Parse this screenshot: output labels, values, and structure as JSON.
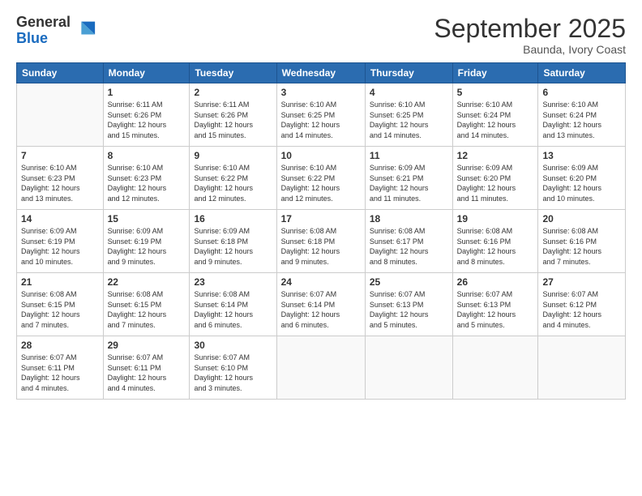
{
  "logo": {
    "general": "General",
    "blue": "Blue"
  },
  "title": "September 2025",
  "location": "Baunda, Ivory Coast",
  "days_of_week": [
    "Sunday",
    "Monday",
    "Tuesday",
    "Wednesday",
    "Thursday",
    "Friday",
    "Saturday"
  ],
  "weeks": [
    [
      {
        "day": "",
        "info": ""
      },
      {
        "day": "1",
        "info": "Sunrise: 6:11 AM\nSunset: 6:26 PM\nDaylight: 12 hours\nand 15 minutes."
      },
      {
        "day": "2",
        "info": "Sunrise: 6:11 AM\nSunset: 6:26 PM\nDaylight: 12 hours\nand 15 minutes."
      },
      {
        "day": "3",
        "info": "Sunrise: 6:10 AM\nSunset: 6:25 PM\nDaylight: 12 hours\nand 14 minutes."
      },
      {
        "day": "4",
        "info": "Sunrise: 6:10 AM\nSunset: 6:25 PM\nDaylight: 12 hours\nand 14 minutes."
      },
      {
        "day": "5",
        "info": "Sunrise: 6:10 AM\nSunset: 6:24 PM\nDaylight: 12 hours\nand 14 minutes."
      },
      {
        "day": "6",
        "info": "Sunrise: 6:10 AM\nSunset: 6:24 PM\nDaylight: 12 hours\nand 13 minutes."
      }
    ],
    [
      {
        "day": "7",
        "info": "Sunrise: 6:10 AM\nSunset: 6:23 PM\nDaylight: 12 hours\nand 13 minutes."
      },
      {
        "day": "8",
        "info": "Sunrise: 6:10 AM\nSunset: 6:23 PM\nDaylight: 12 hours\nand 12 minutes."
      },
      {
        "day": "9",
        "info": "Sunrise: 6:10 AM\nSunset: 6:22 PM\nDaylight: 12 hours\nand 12 minutes."
      },
      {
        "day": "10",
        "info": "Sunrise: 6:10 AM\nSunset: 6:22 PM\nDaylight: 12 hours\nand 12 minutes."
      },
      {
        "day": "11",
        "info": "Sunrise: 6:09 AM\nSunset: 6:21 PM\nDaylight: 12 hours\nand 11 minutes."
      },
      {
        "day": "12",
        "info": "Sunrise: 6:09 AM\nSunset: 6:20 PM\nDaylight: 12 hours\nand 11 minutes."
      },
      {
        "day": "13",
        "info": "Sunrise: 6:09 AM\nSunset: 6:20 PM\nDaylight: 12 hours\nand 10 minutes."
      }
    ],
    [
      {
        "day": "14",
        "info": "Sunrise: 6:09 AM\nSunset: 6:19 PM\nDaylight: 12 hours\nand 10 minutes."
      },
      {
        "day": "15",
        "info": "Sunrise: 6:09 AM\nSunset: 6:19 PM\nDaylight: 12 hours\nand 9 minutes."
      },
      {
        "day": "16",
        "info": "Sunrise: 6:09 AM\nSunset: 6:18 PM\nDaylight: 12 hours\nand 9 minutes."
      },
      {
        "day": "17",
        "info": "Sunrise: 6:08 AM\nSunset: 6:18 PM\nDaylight: 12 hours\nand 9 minutes."
      },
      {
        "day": "18",
        "info": "Sunrise: 6:08 AM\nSunset: 6:17 PM\nDaylight: 12 hours\nand 8 minutes."
      },
      {
        "day": "19",
        "info": "Sunrise: 6:08 AM\nSunset: 6:16 PM\nDaylight: 12 hours\nand 8 minutes."
      },
      {
        "day": "20",
        "info": "Sunrise: 6:08 AM\nSunset: 6:16 PM\nDaylight: 12 hours\nand 7 minutes."
      }
    ],
    [
      {
        "day": "21",
        "info": "Sunrise: 6:08 AM\nSunset: 6:15 PM\nDaylight: 12 hours\nand 7 minutes."
      },
      {
        "day": "22",
        "info": "Sunrise: 6:08 AM\nSunset: 6:15 PM\nDaylight: 12 hours\nand 7 minutes."
      },
      {
        "day": "23",
        "info": "Sunrise: 6:08 AM\nSunset: 6:14 PM\nDaylight: 12 hours\nand 6 minutes."
      },
      {
        "day": "24",
        "info": "Sunrise: 6:07 AM\nSunset: 6:14 PM\nDaylight: 12 hours\nand 6 minutes."
      },
      {
        "day": "25",
        "info": "Sunrise: 6:07 AM\nSunset: 6:13 PM\nDaylight: 12 hours\nand 5 minutes."
      },
      {
        "day": "26",
        "info": "Sunrise: 6:07 AM\nSunset: 6:13 PM\nDaylight: 12 hours\nand 5 minutes."
      },
      {
        "day": "27",
        "info": "Sunrise: 6:07 AM\nSunset: 6:12 PM\nDaylight: 12 hours\nand 4 minutes."
      }
    ],
    [
      {
        "day": "28",
        "info": "Sunrise: 6:07 AM\nSunset: 6:11 PM\nDaylight: 12 hours\nand 4 minutes."
      },
      {
        "day": "29",
        "info": "Sunrise: 6:07 AM\nSunset: 6:11 PM\nDaylight: 12 hours\nand 4 minutes."
      },
      {
        "day": "30",
        "info": "Sunrise: 6:07 AM\nSunset: 6:10 PM\nDaylight: 12 hours\nand 3 minutes."
      },
      {
        "day": "",
        "info": ""
      },
      {
        "day": "",
        "info": ""
      },
      {
        "day": "",
        "info": ""
      },
      {
        "day": "",
        "info": ""
      }
    ]
  ]
}
